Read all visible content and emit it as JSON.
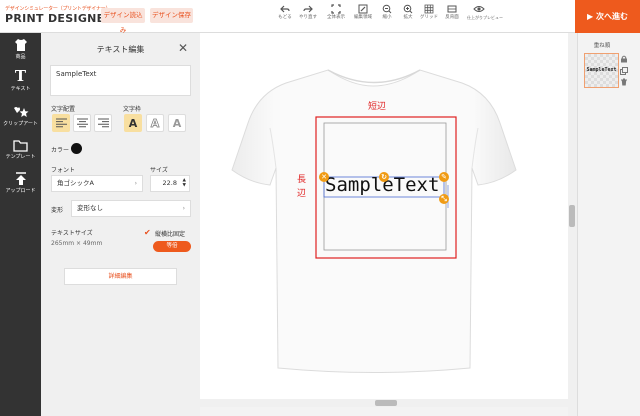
{
  "header": {
    "logo_sub": "デザインシミュレーター（プリントデザイナー）",
    "logo_main": "PRINT DESIGNER",
    "load_design": "デザイン読込み",
    "save_design": "デザイン保存",
    "tools": [
      {
        "icon": "undo-icon",
        "label": "もどる"
      },
      {
        "icon": "redo-icon",
        "label": "やり直す"
      },
      {
        "icon": "fullscreen-icon",
        "label": "全体表示"
      },
      {
        "icon": "edit-area-icon",
        "label": "編集領域"
      },
      {
        "icon": "zoom-out-icon",
        "label": "縮小"
      },
      {
        "icon": "zoom-in-icon",
        "label": "拡大"
      },
      {
        "icon": "grid-icon",
        "label": "グリッド"
      },
      {
        "icon": "back-side-icon",
        "label": "反背面"
      },
      {
        "icon": "preview-icon",
        "label": "仕上がりプレビュー"
      }
    ],
    "next": "次へ進む"
  },
  "rail": [
    {
      "icon": "tshirt-icon",
      "label": "商品"
    },
    {
      "icon": "text-icon",
      "label": "テキスト"
    },
    {
      "icon": "clipart-icon",
      "label": "クリップアート"
    },
    {
      "icon": "folder-icon",
      "label": "テンプレート"
    },
    {
      "icon": "upload-icon",
      "label": "アップロード"
    }
  ],
  "panel": {
    "title": "テキスト編集",
    "text_value": "SampleText",
    "align_label": "文字配置",
    "frame_label": "文字枠",
    "frame_glyph": "A",
    "color_label": "カラー",
    "color": "#111111",
    "font_label": "フォント",
    "font_value": "角ゴシックA",
    "size_label": "サイズ",
    "size_value": "22.8",
    "transform_label": "変形",
    "transform_value": "変形なし",
    "textsize_label": "テキストサイズ",
    "textsize_value": "265mm × 49mm",
    "ratio_label": "縦横比固定",
    "ratio_tag": "等倍",
    "detail_button": "詳細編集"
  },
  "canvas": {
    "short_side": "短辺",
    "long_side": "長辺",
    "sample_text": "SampleText"
  },
  "layers": {
    "title": "重ね順",
    "item_text": "SampleText"
  }
}
